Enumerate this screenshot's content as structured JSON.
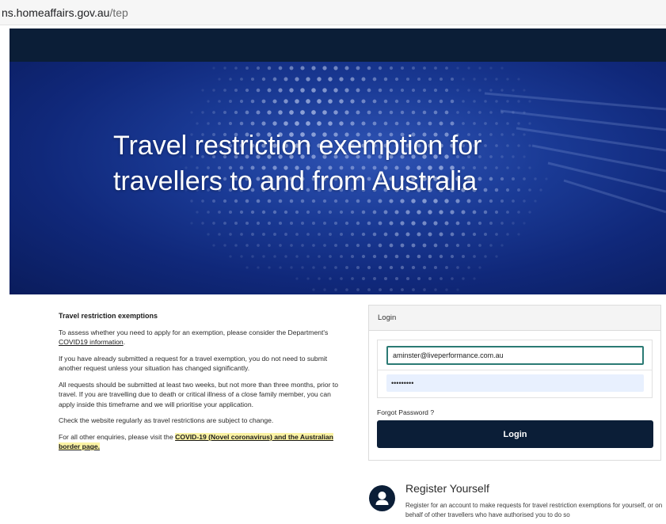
{
  "browser": {
    "url_host": "ns.homeaffairs.gov.au",
    "url_path": "/tep"
  },
  "hero": {
    "title": "Travel restriction exemption for travellers to and from Australia"
  },
  "info": {
    "heading": "Travel restriction exemptions",
    "p1_pre": "To assess whether you need to apply for an exemption, please consider the Department's ",
    "p1_link": "COVID19 information",
    "p1_post": ".",
    "p2": "If you have already submitted a request for a travel exemption, you do not need to submit another request unless your situation has changed significantly.",
    "p3": "All requests should be submitted at least two weeks, but not more than three months, prior to travel. If you are travelling due to death or critical illness of a close family member, you can apply inside this timeframe and we will prioritise your application.",
    "p4": "Check the website regularly as travel restrictions are subject to change.",
    "p5_pre": "For all other enquiries, please visit the ",
    "p5_link": "COVID-19 (Novel coronavirus) and the Australian border page."
  },
  "login": {
    "header": "Login",
    "email_value": "aminster@liveperformance.com.au",
    "password_value": "xxxxxxxxx",
    "forgot_label": "Forgot Password ?",
    "button_label": "Login"
  },
  "register": {
    "title": "Register Yourself",
    "description": "Register for an account to make requests for travel restriction exemptions for yourself, or on behalf of other travellers who have authorised you to do so"
  },
  "colors": {
    "navy": "#0b1e37",
    "hero_blue": "#1a3a95",
    "highlight": "#fbf3a4",
    "input_focus": "#2b7a74"
  },
  "icons": {
    "register": "user-icon"
  }
}
